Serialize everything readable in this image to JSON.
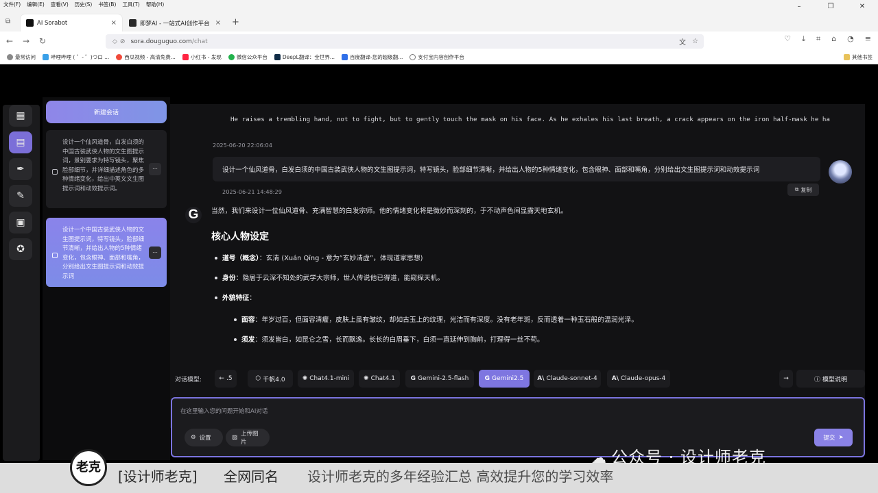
{
  "browser": {
    "menu": [
      "文件(F)",
      "编辑(E)",
      "查看(V)",
      "历史(S)",
      "书签(B)",
      "工具(T)",
      "帮助(H)"
    ],
    "tabs": [
      {
        "title": "AI Sorabot",
        "active": true
      },
      {
        "title": "即梦AI - 一站式AI创作平台",
        "active": false
      }
    ],
    "url_domain": "sora.douguguo.com",
    "url_path": "/chat",
    "bookmarks": [
      "最常访问",
      "哔哩哔哩 ( ゜- ゜)つロ ...",
      "西瓜视频 - 高清免费...",
      "小红书 - 发现",
      "微信公众平台",
      "DeepL翻译：全世界...",
      "百度翻译-您的超级翻...",
      "支付宝内容创作平台"
    ],
    "bookmarks_other": "其他书签"
  },
  "sidebar": {
    "new_chat": "新建会话",
    "conversations": [
      {
        "text": "设计一个仙风道骨，白发白须的中国古装武侠人物的文生图提示词，景别要求为特写镜头，聚焦脸部细节，并详细描述角色的多种情绪变化，给出中英文文生图提示词和动效提示词。",
        "active": false
      },
      {
        "text": "设计一个中国古装武侠人物的文生图提示词，特写镜头，脸部细节清晰，并给出人物的5种情绪变化，包含眼神、面部和嘴角，分别给出文生图提示词和动效提示词",
        "active": true
      }
    ]
  },
  "chat": {
    "prev_output": "He raises a trembling hand, not to fight, but to gently touch the mask on his face. As he exhales his last breath, a crack appears on the iron half-mask he ha",
    "prev_timestamp": "2025-06-20 22:06:04",
    "user_message": "设计一个仙风道骨，白发白须的中国古装武侠人物的文生图提示词，特写镜头，脸部细节清晰，并给出人物的5种情绪变化，包含眼神、面部和嘴角，分别给出文生图提示词和动效提示词",
    "user_timestamp": "2025-06-21 14:48:29",
    "copy_label": "复制",
    "ai_intro": "当然，我们来设计一位仙风道骨、充满智慧的白发宗师。他的情绪变化将是微妙而深刻的，于不动声色间显露天地玄机。",
    "ai_heading": "核心人物设定",
    "b1_key": "道号（概念）",
    "b1_val": "：玄清 (Xuán Qīng - 意为“玄妙清虚”，体现道家思想)",
    "b2_key": "身份",
    "b2_val": "：隐居于云深不知处的武学大宗师，世人传说他已得道，能窥探天机。",
    "b3_key": "外貌特征",
    "b3_val": "：",
    "s1_key": "面容",
    "s1_val": "：年岁过百，但面容清癯，皮肤上虽有皱纹，却如古玉上的纹理，光洁而有深度。没有老年斑，反而透着一种玉石般的温润光泽。",
    "s2_key": "须发",
    "s2_val": "：须发皆白，如昆仑之雪，长而飘逸。长长的白眉垂下，白须一直延伸到胸前，打理得一丝不苟。"
  },
  "models": {
    "label": "对话模型:",
    "items": [
      {
        "name": ".5",
        "icon": "left-arrow-icon",
        "active": false
      },
      {
        "name": "千帆4.0",
        "icon": "qianfan-icon",
        "active": false
      },
      {
        "name": "Chat4.1-mini",
        "icon": "openai-icon",
        "active": false
      },
      {
        "name": "Chat4.1",
        "icon": "openai-icon",
        "active": false
      },
      {
        "name": "Gemini-2.5-flash",
        "icon": "google-icon",
        "active": false
      },
      {
        "name": "Gemini2.5",
        "icon": "google-icon",
        "active": true
      },
      {
        "name": "Claude-sonnet-4",
        "icon": "anthropic-icon",
        "active": false
      },
      {
        "name": "Claude-opus-4",
        "icon": "anthropic-icon",
        "active": false
      }
    ],
    "help": "模型说明"
  },
  "input": {
    "placeholder": "在这里输入您的问题开始和AI对话",
    "settings": "设置",
    "upload": "上传图片",
    "submit": "提交"
  },
  "overlay": {
    "watermark": "公众号 · 设计师老克",
    "logo_text": "老克",
    "band_1": "[设计师老克]",
    "band_2": "全网同名",
    "band_3": "设计师老克的多年经验汇总 高效提升您的学习效率"
  },
  "colors": {
    "accent": "#7e76e0",
    "bg": "#000000",
    "panel": "#121214"
  }
}
